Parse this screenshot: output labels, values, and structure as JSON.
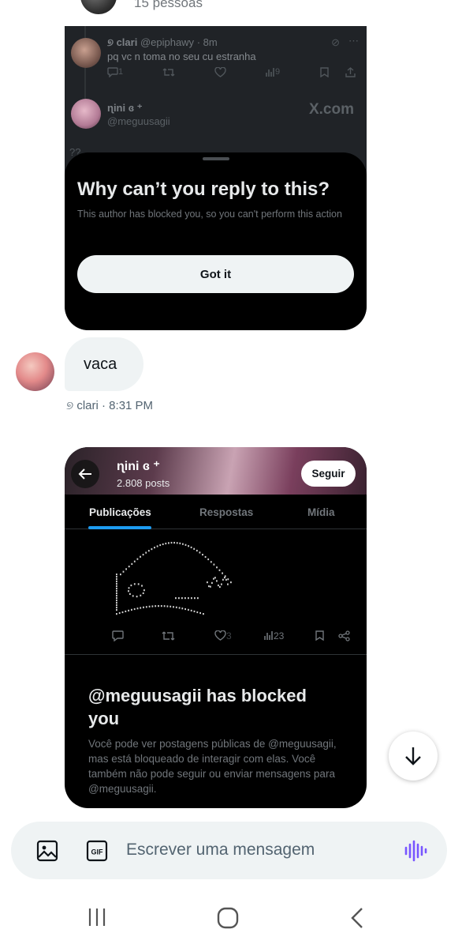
{
  "header": {
    "count_text": "15 pessoas"
  },
  "card1": {
    "tweet": {
      "name": "୭ clari",
      "handle": "@epiphawy",
      "time": "· 8m",
      "text": "pq vc n toma no seu cu estranha",
      "replies": "1",
      "views": "9"
    },
    "author": {
      "name": "ɳini ɞ ⁺",
      "handle": "@meguusagii"
    },
    "source": "X.com",
    "cut_text": "?? ...",
    "sheet": {
      "title": "Why can’t you reply to this?",
      "text": "This author has blocked you, so you can't perform this action",
      "button": "Got it"
    }
  },
  "message": {
    "text": "vaca",
    "meta": "୭ clari · 8:31 PM"
  },
  "card2": {
    "profile_name": "ɳini ɞ ⁺",
    "posts": "2.808 posts",
    "follow": "Seguir",
    "tabs": [
      "Publicações",
      "Respostas",
      "Mídia"
    ],
    "post": {
      "likes": "3",
      "views": "23"
    },
    "blocked_title": "@meguusagii has blocked you",
    "blocked_text": "Você pode ver postagens públicas de @meguusagii, mas está bloqueado de interagir com elas. Você também não pode seguir ou enviar mensagens para @meguusagii."
  },
  "composer": {
    "placeholder": "Escrever uma mensagem",
    "accent": "#7856ff"
  },
  "colors": {
    "link_blue": "#1d9bf0",
    "dark_bg": "#000000",
    "bubble": "#eff3f4"
  }
}
